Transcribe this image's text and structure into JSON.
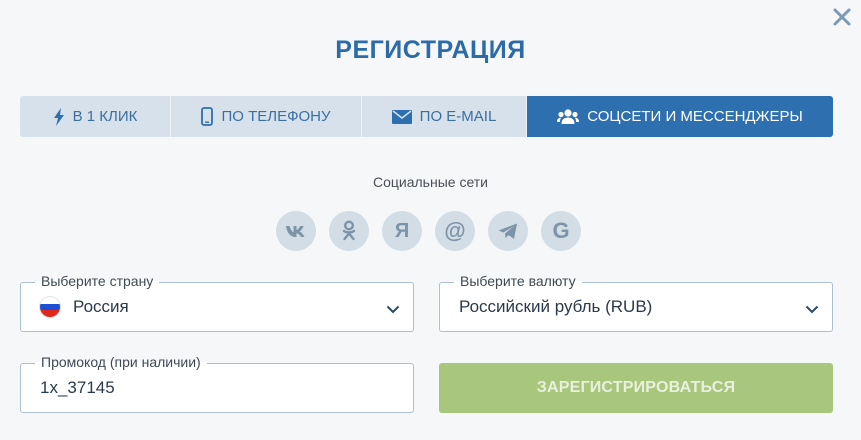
{
  "title": "РЕГИСТРАЦИЯ",
  "tabs": [
    {
      "label": "В 1 КЛИК",
      "icon": "lightning-icon",
      "active": false
    },
    {
      "label": "ПО ТЕЛЕФОНУ",
      "icon": "phone-icon",
      "active": false
    },
    {
      "label": "ПО E-MAIL",
      "icon": "envelope-icon",
      "active": false
    },
    {
      "label": "СОЦСЕТИ И МЕССЕНДЖЕРЫ",
      "icon": "users-icon",
      "active": true
    }
  ],
  "social": {
    "label": "Социальные сети",
    "items": [
      {
        "icon": "vk-icon",
        "glyph": "vk"
      },
      {
        "icon": "odnoklassniki-icon",
        "glyph": "ok"
      },
      {
        "icon": "yandex-icon",
        "glyph": "Я"
      },
      {
        "icon": "mailru-icon",
        "glyph": "@"
      },
      {
        "icon": "telegram-icon",
        "glyph": "tg"
      },
      {
        "icon": "google-icon",
        "glyph": "G"
      }
    ]
  },
  "country": {
    "label": "Выберите страну",
    "value": "Россия"
  },
  "currency": {
    "label": "Выберите валюту",
    "value": "Российский рубль (RUB)"
  },
  "promo": {
    "label": "Промокод (при наличии)",
    "value": "1x_37145"
  },
  "register_label": "ЗАРЕГИСТРИРОВАТЬСЯ",
  "colors": {
    "accent": "#2e6fb0",
    "tab_bg": "#d6e1eb",
    "register_button": "#a8c67c",
    "social_bg": "#d3dde6"
  }
}
